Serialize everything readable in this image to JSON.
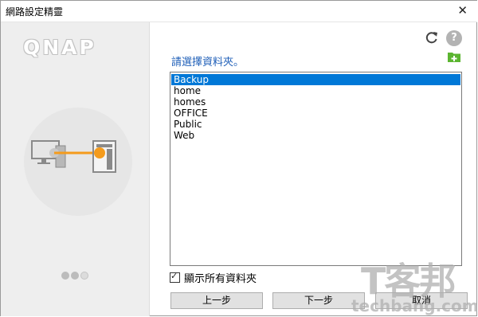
{
  "window": {
    "title": "網路設定精靈",
    "close_label": "✕"
  },
  "brand": {
    "logo_text": "QNAP"
  },
  "illustration": {
    "accent_color": "#f49b1c",
    "device_color": "#8a8a8a"
  },
  "progress_dots": {
    "count": 3
  },
  "toolbar": {
    "refresh_icon": "refresh-icon",
    "help_label": "?",
    "new_folder_icon": "new-folder-icon"
  },
  "prompt": "請選擇資料夾。",
  "folders": {
    "selected_index": 0,
    "items": [
      "Backup",
      "home",
      "homes",
      "OFFICE",
      "Public",
      "Web"
    ]
  },
  "show_all": {
    "label": "顯示所有資料夾",
    "checked": true
  },
  "buttons": {
    "prev": "上一步",
    "next": "下一步",
    "cancel": "取消"
  },
  "watermark": {
    "main": "T客邦",
    "sub": "techbang.com"
  },
  "colors": {
    "selection": "#0078d7",
    "prompt_text": "#1f5fb8",
    "new_folder_green": "#5cb531"
  }
}
